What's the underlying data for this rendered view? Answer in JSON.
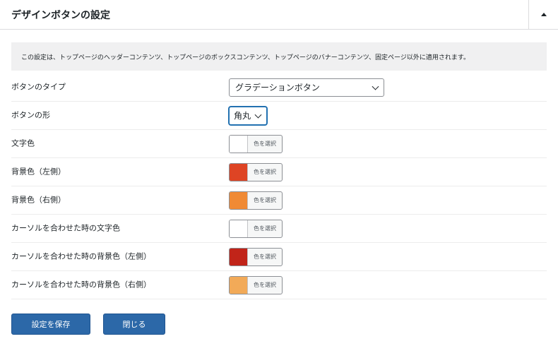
{
  "header": {
    "title": "デザインボタンの設定",
    "toggle_icon": "triangle-up-icon"
  },
  "notice": "この設定は、トップページのヘッダーコンテンツ、トップページのボックスコンテンツ、トップページのバナーコンテンツ、固定ページ以外に適用されます。",
  "fields": {
    "button_type": {
      "label": "ボタンのタイプ",
      "value": "グラデーションボタン"
    },
    "button_shape": {
      "label": "ボタンの形",
      "value": "角丸"
    },
    "color_pick_label": "色を選択",
    "text_color": {
      "label": "文字色",
      "color": "#ffffff"
    },
    "bg_left": {
      "label": "背景色（左側）",
      "color": "#de4424"
    },
    "bg_right": {
      "label": "背景色（右側）",
      "color": "#f08a34"
    },
    "hover_text_color": {
      "label": "カーソルを合わせた時の文字色",
      "color": "#ffffff"
    },
    "hover_bg_left": {
      "label": "カーソルを合わせた時の背景色（左側）",
      "color": "#c12419"
    },
    "hover_bg_right": {
      "label": "カーソルを合わせた時の背景色（右側）",
      "color": "#f2aa58"
    }
  },
  "buttons": {
    "save": "設定を保存",
    "close": "閉じる"
  },
  "colors": {
    "primary_button": "#2c68a8",
    "focus_border": "#2271b1"
  }
}
